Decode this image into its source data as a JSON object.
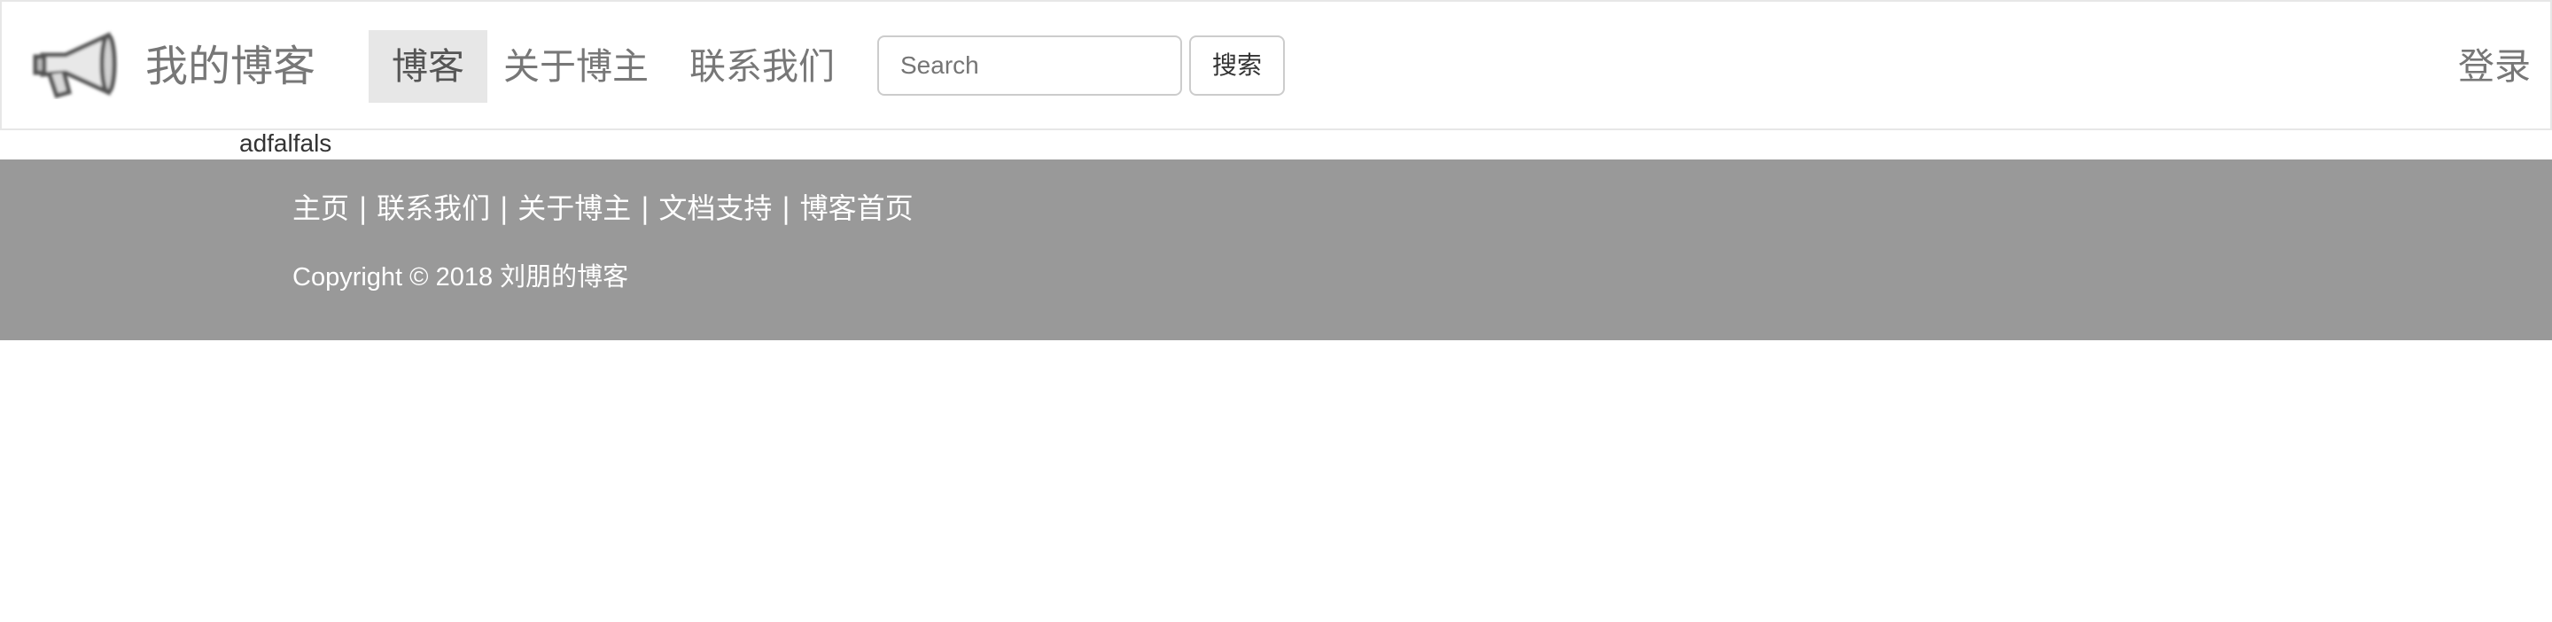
{
  "navbar": {
    "brand": "我的博客",
    "logo_icon": "megaphone-icon",
    "items": [
      {
        "label": "博客",
        "active": true
      },
      {
        "label": "关于博主",
        "active": false
      },
      {
        "label": "联系我们",
        "active": false
      }
    ],
    "search": {
      "placeholder": "Search",
      "value": "",
      "button_label": "搜索"
    },
    "login_label": "登录"
  },
  "content": {
    "text": "adfalfals"
  },
  "footer": {
    "links": [
      "主页",
      "联系我们",
      "关于博主",
      "文档支持",
      "博客首页"
    ],
    "separator": "|",
    "copyright": "Copyright © 2018 刘朋的博客"
  }
}
